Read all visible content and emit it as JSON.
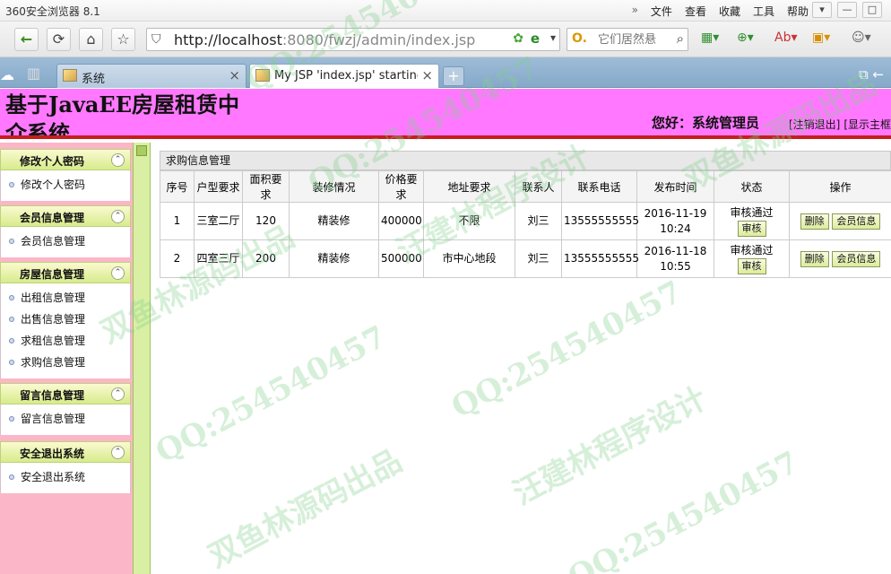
{
  "browser": {
    "app_title": "360安全浏览器 8.1",
    "menu": {
      "arrow": "»",
      "items": [
        "文件",
        "查看",
        "收藏",
        "工具",
        "帮助"
      ]
    },
    "url_host": "http://localhost",
    "url_rest": ":8080/fwzj/admin/index.jsp",
    "search_placeholder": "它们居然悬",
    "tabs": [
      {
        "label": "系统",
        "close": "×"
      },
      {
        "label": "My JSP 'index.jsp' starting p",
        "close": "×"
      }
    ],
    "new_tab": "+"
  },
  "header": {
    "title": "基于JavaEE房屋租赁中介系统",
    "greeting": "您好：系统管理员",
    "logout": "[注销退出]",
    "show_home": "[显示主框"
  },
  "sidebar": {
    "groups": [
      {
        "title": "修改个人密码",
        "items": [
          "修改个人密码"
        ]
      },
      {
        "title": "会员信息管理",
        "items": [
          "会员信息管理"
        ]
      },
      {
        "title": "房屋信息管理",
        "items": [
          "出租信息管理",
          "出售信息管理",
          "求租信息管理",
          "求购信息管理"
        ]
      },
      {
        "title": "留言信息管理",
        "items": [
          "留言信息管理"
        ]
      },
      {
        "title": "安全退出系统",
        "items": [
          "安全退出系统"
        ]
      }
    ]
  },
  "panel": {
    "title": "求购信息管理",
    "columns": [
      "序号",
      "户型要求",
      "面积要求",
      "装修情况",
      "价格要求",
      "地址要求",
      "联系人",
      "联系电话",
      "发布时间",
      "状态",
      "操作"
    ],
    "rows": [
      {
        "no": "1",
        "type": "三室二厅",
        "area": "120",
        "decor": "精装修",
        "price": "400000",
        "address": "不限",
        "contact": "刘三",
        "phone": "13555555555",
        "time": "2016-11-19 10:24",
        "status": "审核通过",
        "audit_btn": "审核",
        "delete_btn": "删除",
        "member_btn": "会员信息"
      },
      {
        "no": "2",
        "type": "四室三厅",
        "area": "200",
        "decor": "精装修",
        "price": "500000",
        "address": "市中心地段",
        "contact": "刘三",
        "phone": "13555555555",
        "time": "2016-11-18 10:55",
        "status": "审核通过",
        "audit_btn": "审核",
        "delete_btn": "删除",
        "member_btn": "会员信息"
      }
    ]
  },
  "watermarks": [
    "QQ:254540457",
    "双鱼林源码出品",
    "汪建林程序设计"
  ]
}
